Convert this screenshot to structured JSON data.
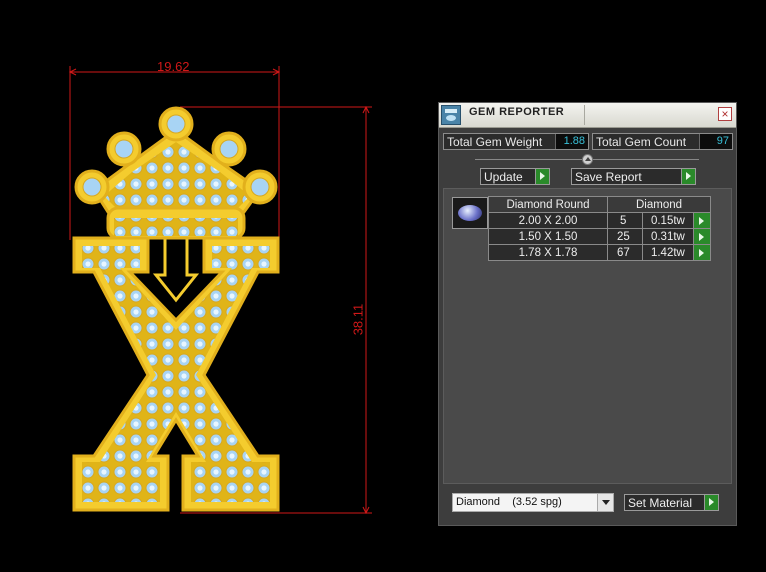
{
  "drawing": {
    "width_dimension": "19.62",
    "height_dimension": "38.11",
    "metal_color": "#f2c830",
    "gem_color": "#a8d4f4",
    "dimension_color": "#d01818"
  },
  "gem_reporter": {
    "title": "GEM REPORTER",
    "total_weight_label": "Total Gem Weight",
    "total_weight_value": "1.88",
    "total_count_label": "Total Gem Count",
    "total_count_value": "97",
    "update_label": "Update",
    "save_report_label": "Save Report",
    "table": {
      "headers": [
        "Diamond Round",
        "Diamond"
      ],
      "rows": [
        {
          "size": "2.00 X 2.00",
          "count": "5",
          "weight": "0.15tw"
        },
        {
          "size": "1.50 X 1.50",
          "count": "25",
          "weight": "0.31tw"
        },
        {
          "size": "1.78 X 1.78",
          "count": "67",
          "weight": "1.42tw"
        }
      ]
    },
    "material_select": "Diamond    (3.52 spg)",
    "set_material_label": "Set Material"
  }
}
